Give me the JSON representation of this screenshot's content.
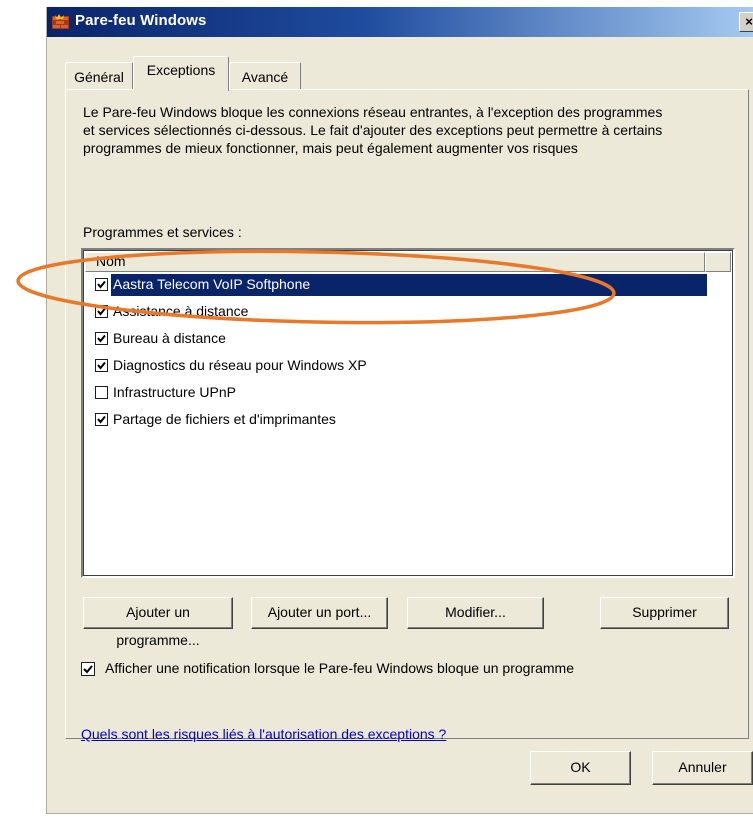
{
  "window": {
    "title": "Pare-feu Windows",
    "close_glyph": "×"
  },
  "tabs": [
    {
      "label": "Général",
      "active": false
    },
    {
      "label": "Exceptions",
      "active": true
    },
    {
      "label": "Avancé",
      "active": false
    }
  ],
  "description": {
    "line1": "Le Pare-feu Windows bloque les connexions réseau entrantes, à l'exception des programmes",
    "line2": "et services sélectionnés ci-dessous. Le fait d'ajouter des exceptions peut permettre à certains",
    "line3": "programmes de mieux fonctionner, mais peut également augmenter vos risques"
  },
  "programs": {
    "section_label": "Programmes et services :",
    "column_header": "Nom",
    "items": [
      {
        "label": "Aastra Telecom VoIP Softphone",
        "checked": true,
        "selected": true
      },
      {
        "label": "Assistance à distance",
        "checked": true,
        "selected": false
      },
      {
        "label": "Bureau à distance",
        "checked": true,
        "selected": false
      },
      {
        "label": "Diagnostics du réseau pour Windows XP",
        "checked": true,
        "selected": false
      },
      {
        "label": "Infrastructure UPnP",
        "checked": false,
        "selected": false
      },
      {
        "label": "Partage de fichiers et d'imprimantes",
        "checked": true,
        "selected": false
      }
    ]
  },
  "buttons": {
    "add_program": "Ajouter un programme...",
    "add_port": "Ajouter un port...",
    "modify": "Modifier...",
    "delete": "Supprimer",
    "ok": "OK",
    "cancel": "Annuler"
  },
  "notification": {
    "label": "Afficher une notification lorsque le Pare-feu Windows bloque un programme",
    "checked": true
  },
  "risk_link": "Quels sont les risques liés à l'autorisation des exceptions ?",
  "colors": {
    "selection": "#0a246a",
    "annotation": "#e8782a",
    "dialog_bg": "#ece9d8"
  }
}
